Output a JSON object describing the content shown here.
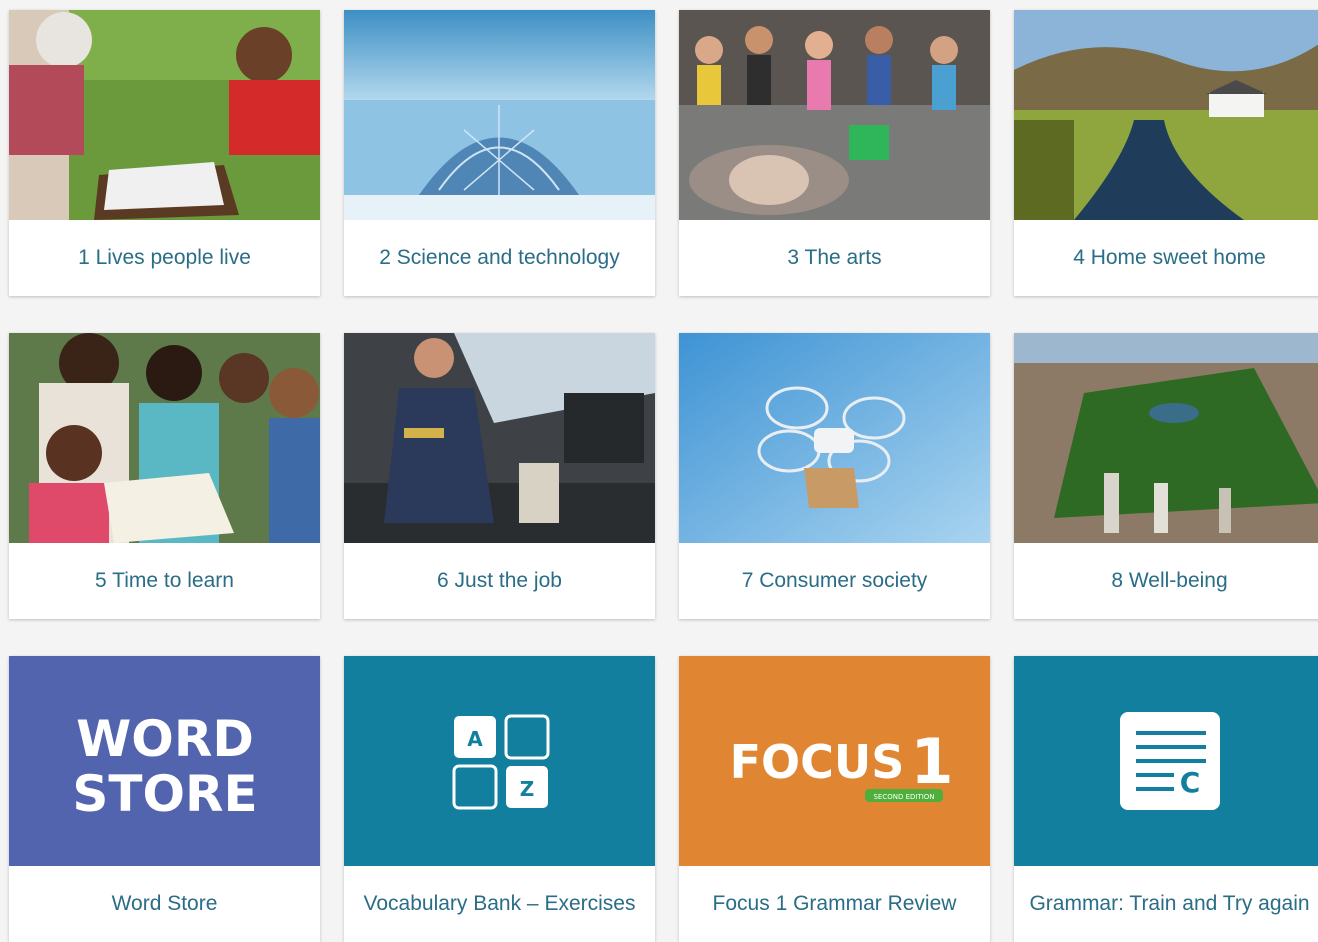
{
  "tiles": [
    {
      "label": "1 Lives people live",
      "image": "chess-grandma-teen-photo"
    },
    {
      "label": "2 Science and technology",
      "image": "polar-dome-station-photo"
    },
    {
      "label": "3 The arts",
      "image": "street-chalk-art-crowd-photo"
    },
    {
      "label": "4 Home sweet home",
      "image": "highland-cottage-river-photo"
    },
    {
      "label": "5 Time to learn",
      "image": "kids-studying-outdoors-photo"
    },
    {
      "label": "6 Just the job",
      "image": "pilot-cockpit-photo"
    },
    {
      "label": "7 Consumer society",
      "image": "delivery-drone-photo"
    },
    {
      "label": "8 Well-being",
      "image": "city-park-aerial-photo"
    },
    {
      "label": "Word Store",
      "image": "word-store-logo",
      "logo_line1": "WORD",
      "logo_line2": "STORE",
      "color": "#5264ae"
    },
    {
      "label": "Vocabulary Bank – Exercises",
      "image": "a-z-vocabulary-icon",
      "letter_a": "A",
      "letter_z": "Z",
      "color": "#127f9e"
    },
    {
      "label": "Focus 1 Grammar Review",
      "image": "focus-1-logo",
      "logo_text": "FOCUS",
      "logo_number": "1",
      "edition": "SECOND EDITION",
      "color": "#e08633"
    },
    {
      "label": "Grammar: Train and Try again",
      "image": "grammar-document-icon",
      "doc_letter": "C",
      "color": "#127f9e"
    }
  ]
}
